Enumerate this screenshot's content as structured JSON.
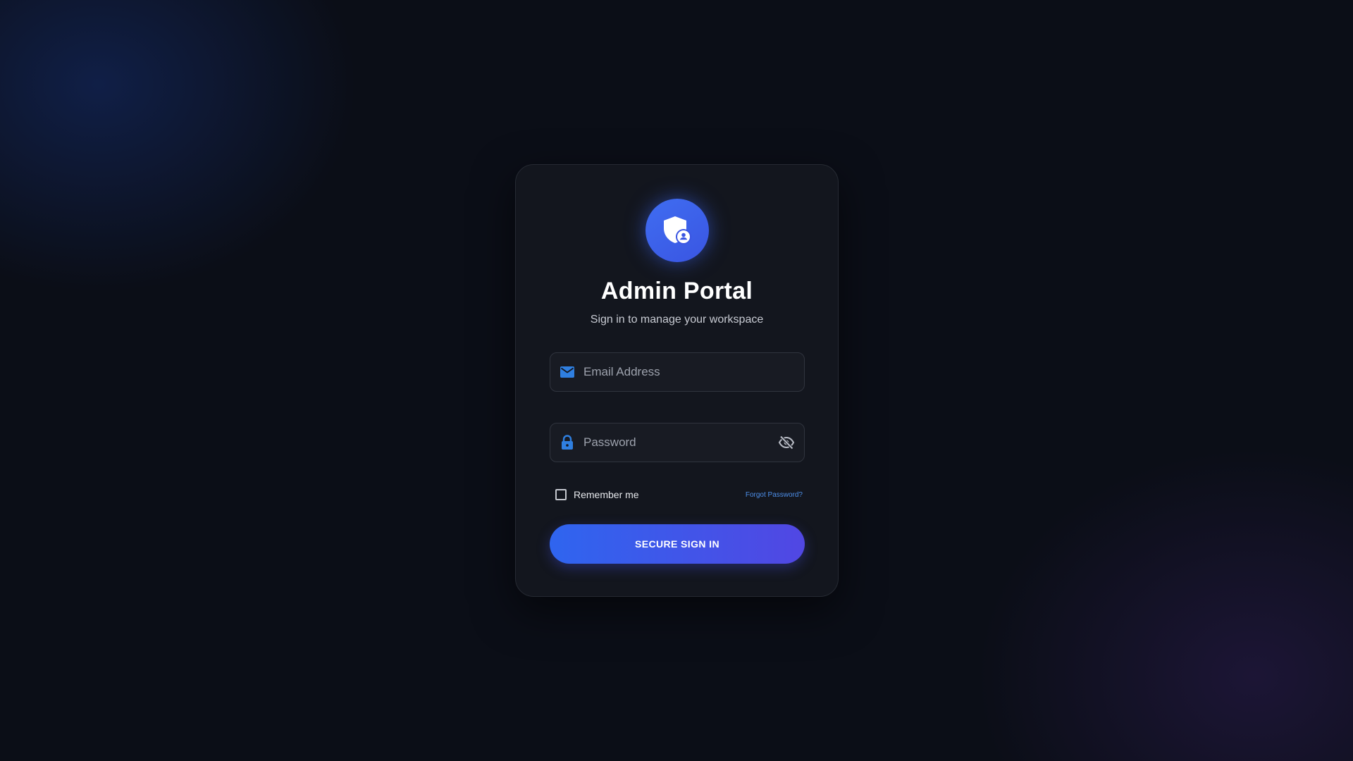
{
  "brand": {
    "logo_icon": "shield-user-icon",
    "title": "Admin Portal",
    "subtitle": "Sign in to manage your workspace"
  },
  "form": {
    "email": {
      "icon": "mail-icon",
      "placeholder": "Email Address",
      "value": ""
    },
    "password": {
      "icon": "lock-icon",
      "placeholder": "Password",
      "value": "",
      "visibility_icon": "eye-off-icon"
    },
    "remember_me": {
      "label": "Remember me",
      "checked": false
    },
    "forgot_password_label": "Forgot Password?",
    "submit_label": "SECURE SIGN IN"
  },
  "colors": {
    "background": "#0b0e17",
    "card": "#13161e",
    "accent": "#3b6cf0",
    "accent_secondary": "#5147e3",
    "link": "#4d8fea",
    "icon_blue": "#2f7fe0"
  }
}
